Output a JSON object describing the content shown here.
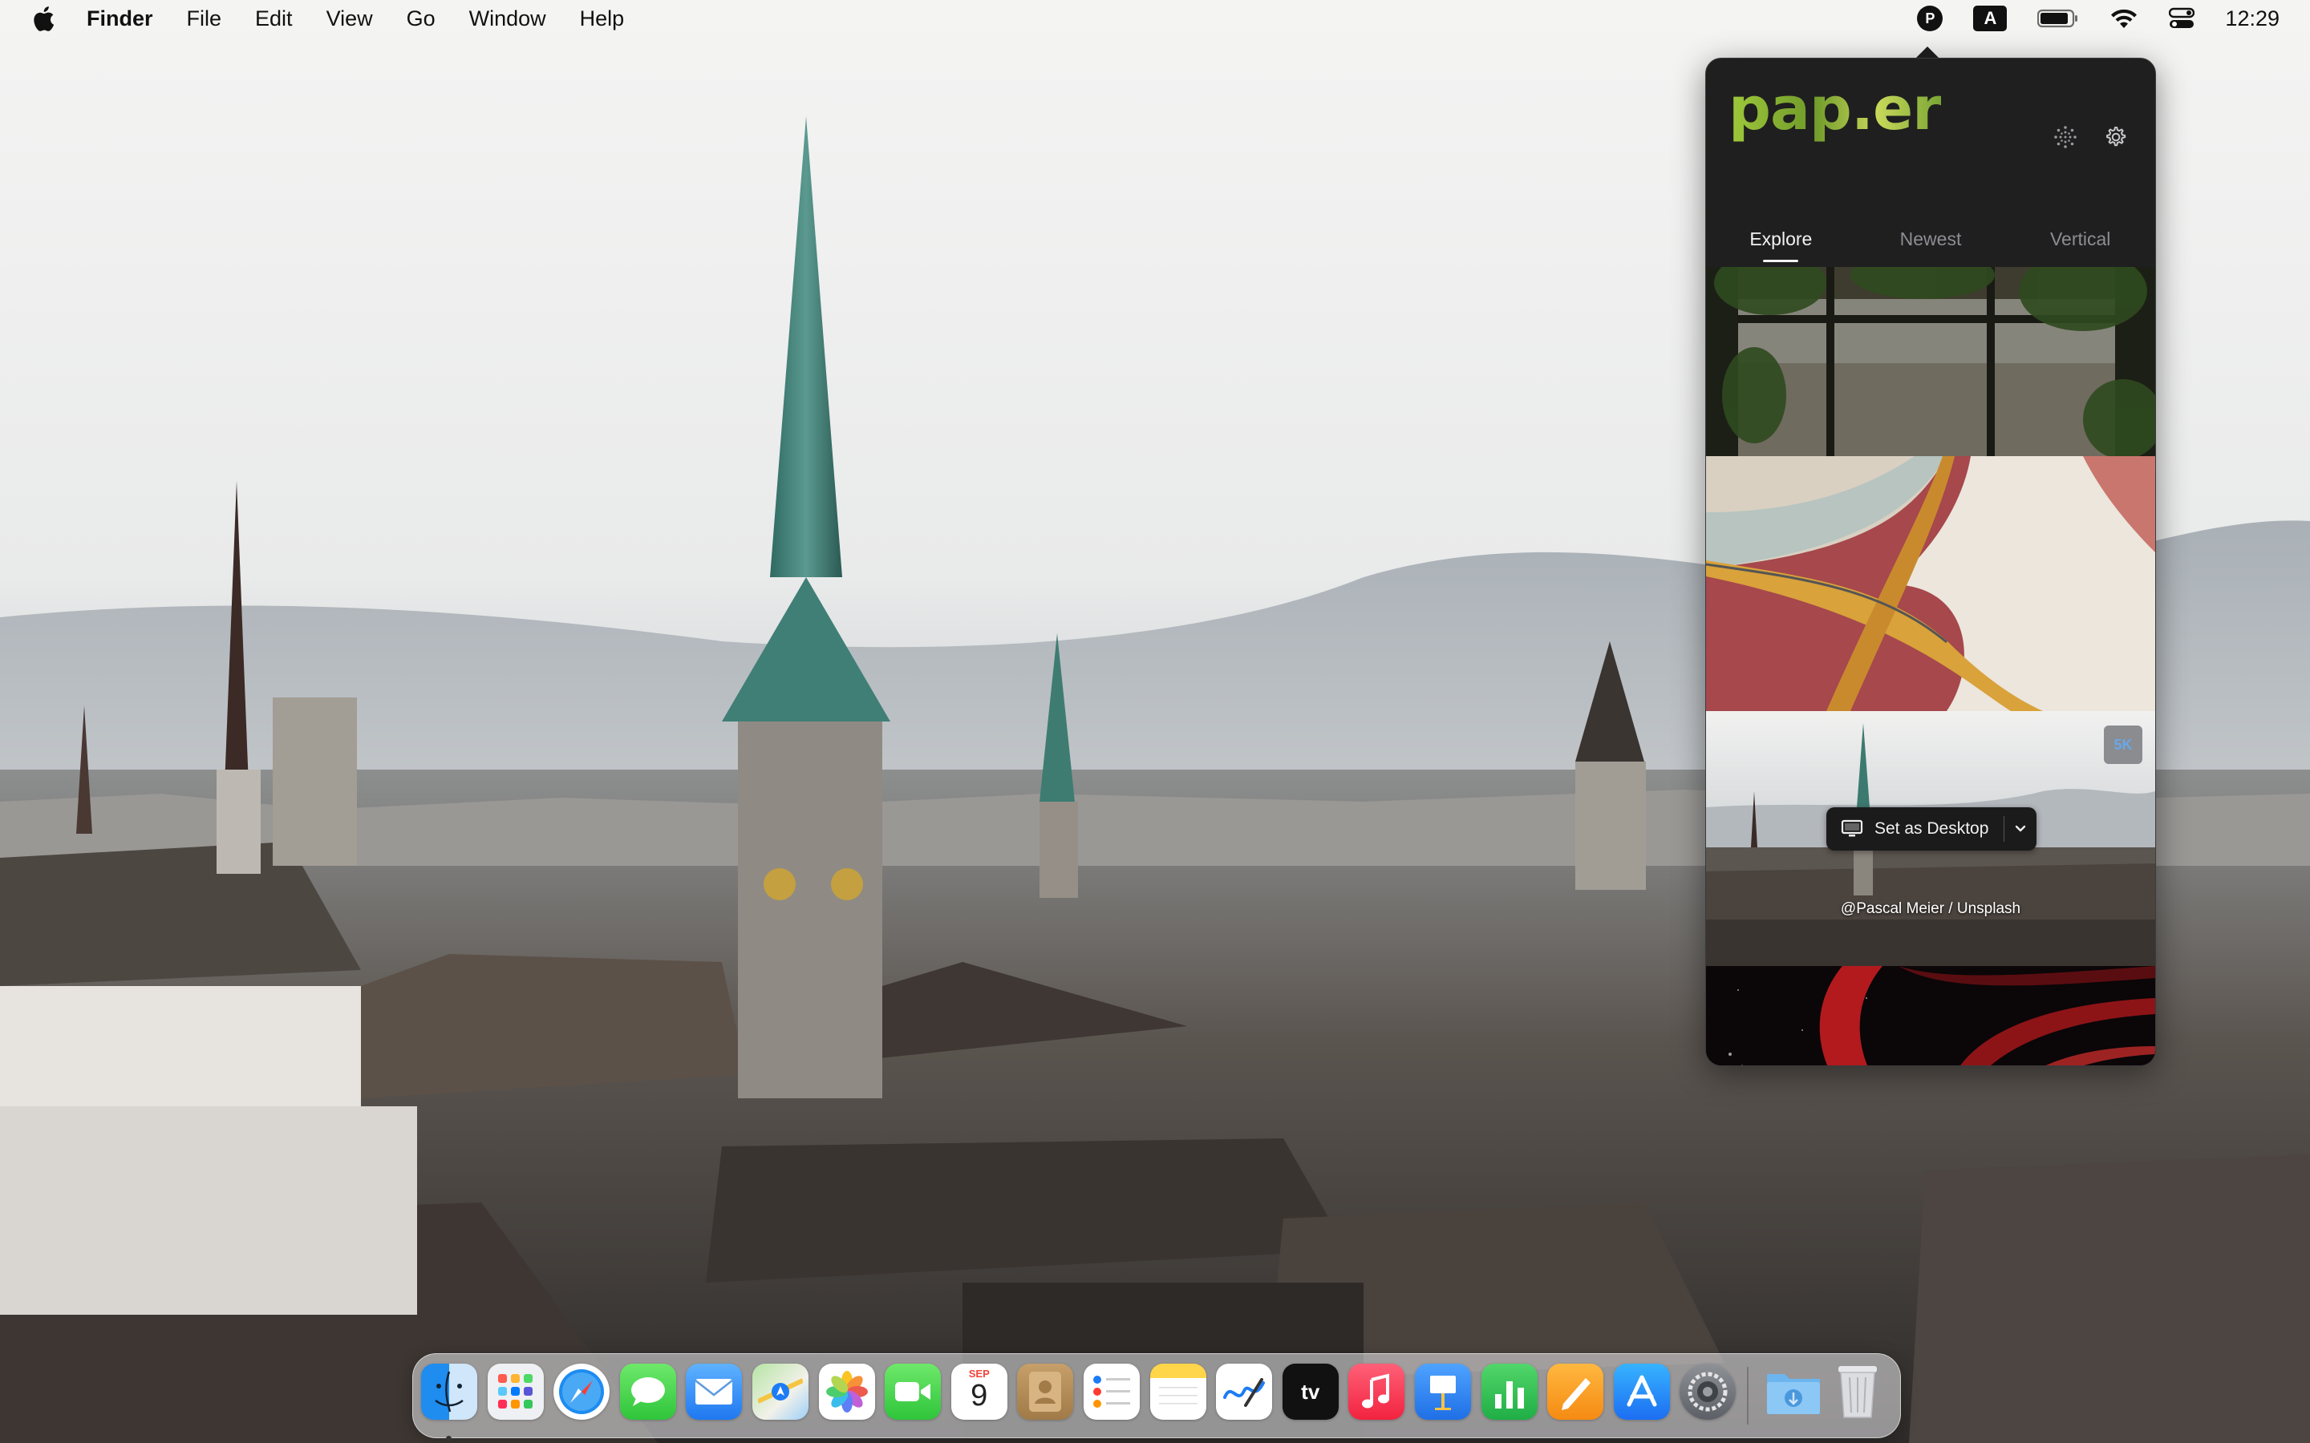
{
  "menubar": {
    "app_name": "Finder",
    "menus": [
      "File",
      "Edit",
      "View",
      "Go",
      "Window",
      "Help"
    ],
    "status": {
      "paper_icon_letter": "P",
      "input_source": "A",
      "clock": "12:29"
    }
  },
  "paper_app": {
    "logo": "pap.er",
    "tabs": [
      {
        "label": "Explore",
        "active": true
      },
      {
        "label": "Newest",
        "active": false
      },
      {
        "label": "Vertical",
        "active": false
      }
    ],
    "hover_item": {
      "resolution_badge": "5K",
      "set_desktop_label": "Set as Desktop",
      "credit": "@Pascal Meier / Unsplash"
    }
  },
  "dock": {
    "apps": [
      "finder-icon",
      "launchpad-icon",
      "safari-icon",
      "messages-icon",
      "mail-icon",
      "maps-icon",
      "photos-icon",
      "facetime-icon",
      "calendar-icon",
      "contacts-icon",
      "reminders-icon",
      "notes-icon",
      "freeform-icon",
      "apple-tv-icon",
      "music-icon",
      "keynote-icon",
      "numbers-icon",
      "pages-icon",
      "app-store-icon",
      "system-settings-icon"
    ],
    "calendar": {
      "month": "SEP",
      "day": "9"
    },
    "tv_label": "tv"
  },
  "colors": {
    "popover_bg": "#1f1f20",
    "logo_green": "#8fbf3a",
    "accent_blue": "#1a7cf5"
  }
}
